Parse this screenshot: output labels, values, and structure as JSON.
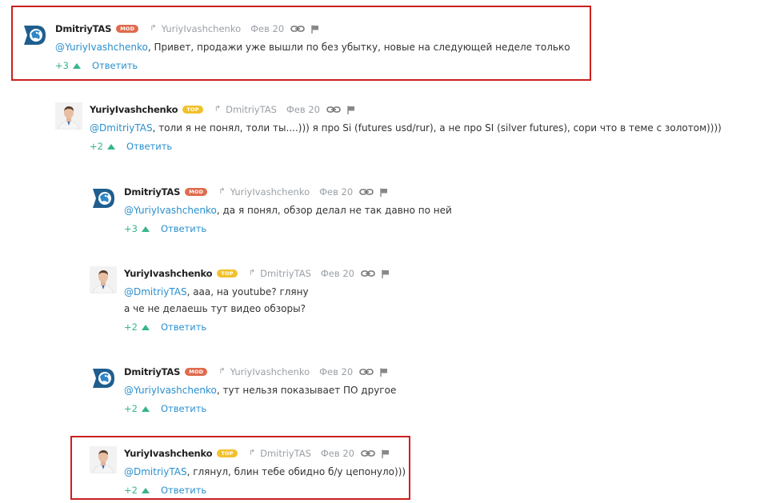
{
  "comments": [
    {
      "author": "DmitriyTAS",
      "badge": "MOD",
      "reply_to": "YuriyIvashchenko",
      "date": "Фев 20",
      "mention": "@YuriyIvashchenko",
      "lines": [
        ", Привет, продажи уже вышли по без убытку, новые на следующей неделе только"
      ],
      "votes": "+3",
      "reply_label": "Ответить"
    },
    {
      "author": "YuriyIvashchenko",
      "badge": "TOP",
      "reply_to": "DmitriyTAS",
      "date": "Фев 20",
      "mention": "@DmitriyTAS",
      "lines": [
        ", толи я не понял, толи ты....))) я про Si (futures usd/rur), а не про SI (silver futures), сори что в теме с золотом))))"
      ],
      "votes": "+2",
      "reply_label": "Ответить"
    },
    {
      "author": "DmitriyTAS",
      "badge": "MOD",
      "reply_to": "YuriyIvashchenko",
      "date": "Фев 20",
      "mention": "@YuriyIvashchenko",
      "lines": [
        ", да я понял, обзор делал не так давно по ней"
      ],
      "votes": "+3",
      "reply_label": "Ответить"
    },
    {
      "author": "YuriyIvashchenko",
      "badge": "TOP",
      "reply_to": "DmitriyTAS",
      "date": "Фев 20",
      "mention": "@DmitriyTAS",
      "lines": [
        ", ааа, на youtube? гляну",
        "а че не делаешь тут видео обзоры?"
      ],
      "votes": "+2",
      "reply_label": "Ответить"
    },
    {
      "author": "DmitriyTAS",
      "badge": "MOD",
      "reply_to": "YuriyIvashchenko",
      "date": "Фев 20",
      "mention": "@YuriyIvashchenko",
      "lines": [
        ", тут нельзя показывает ПО другое"
      ],
      "votes": "+2",
      "reply_label": "Ответить"
    },
    {
      "author": "YuriyIvashchenko",
      "badge": "TOP",
      "reply_to": "DmitriyTAS",
      "date": "Фев 20",
      "mention": "@DmitriyTAS",
      "lines": [
        ", глянул, блин тебе обидно б/у цепонуло)))"
      ],
      "votes": "+2",
      "reply_label": "Ответить"
    }
  ],
  "icons": {
    "reply_arrow": "↱",
    "link": "link-icon",
    "flag": "flag-icon",
    "upvote": "upvote-triangle-icon"
  },
  "colors": {
    "mention": "#2a8fcc",
    "votes": "#37b58c",
    "mod_badge": "#e06b4e",
    "top_badge": "#f2c02a",
    "highlight_border": "#cc1f1f",
    "muted": "#9aa0a6",
    "tas_logo": "#1f5e8e"
  }
}
